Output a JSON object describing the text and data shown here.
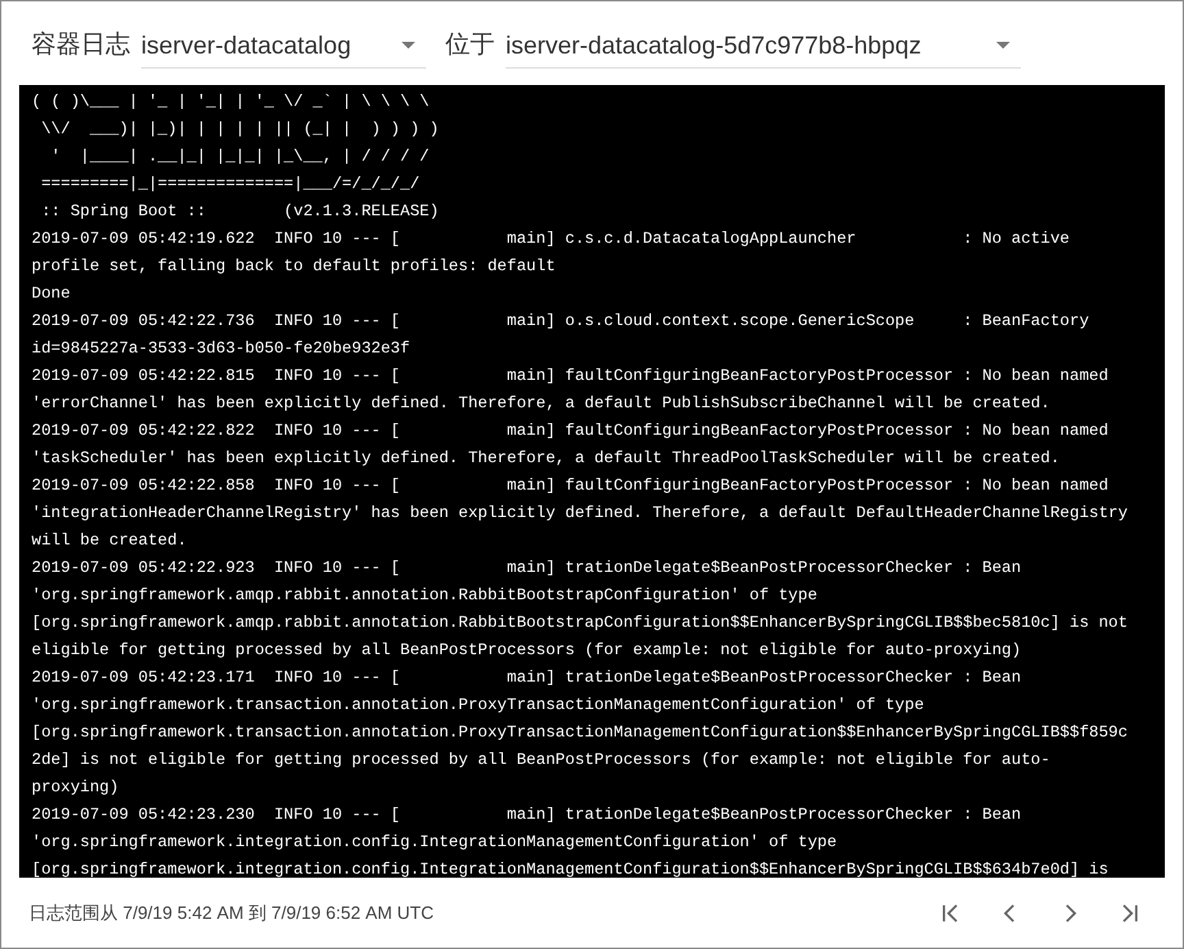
{
  "header": {
    "log_label": "容器日志",
    "container_select": {
      "value": "iserver-datacatalog"
    },
    "location_label": "位于",
    "pod_select": {
      "value": "iserver-datacatalog-5d7c977b8-hbpqz"
    }
  },
  "log_lines": [
    "( ( )\\___ | '_ | '_| | '_ \\/ _` | \\ \\ \\ \\",
    " \\\\/  ___)| |_)| | | | | || (_| |  ) ) ) )",
    "  '  |____| .__|_| |_|_| |_\\__, | / / / /",
    " =========|_|==============|___/=/_/_/_/",
    " :: Spring Boot ::        (v2.1.3.RELEASE)",
    "2019-07-09 05:42:19.622  INFO 10 --- [           main] c.s.c.d.DatacatalogAppLauncher           : No active",
    "profile set, falling back to default profiles: default",
    "Done",
    "2019-07-09 05:42:22.736  INFO 10 --- [           main] o.s.cloud.context.scope.GenericScope     : BeanFactory",
    "id=9845227a-3533-3d63-b050-fe20be932e3f",
    "2019-07-09 05:42:22.815  INFO 10 --- [           main] faultConfiguringBeanFactoryPostProcessor : No bean named",
    "'errorChannel' has been explicitly defined. Therefore, a default PublishSubscribeChannel will be created.",
    "2019-07-09 05:42:22.822  INFO 10 --- [           main] faultConfiguringBeanFactoryPostProcessor : No bean named",
    "'taskScheduler' has been explicitly defined. Therefore, a default ThreadPoolTaskScheduler will be created.",
    "2019-07-09 05:42:22.858  INFO 10 --- [           main] faultConfiguringBeanFactoryPostProcessor : No bean named",
    "'integrationHeaderChannelRegistry' has been explicitly defined. Therefore, a default DefaultHeaderChannelRegistry",
    "will be created.",
    "2019-07-09 05:42:22.923  INFO 10 --- [           main] trationDelegate$BeanPostProcessorChecker : Bean",
    "'org.springframework.amqp.rabbit.annotation.RabbitBootstrapConfiguration' of type",
    "[org.springframework.amqp.rabbit.annotation.RabbitBootstrapConfiguration$$EnhancerBySpringCGLIB$$bec5810c] is not",
    "eligible for getting processed by all BeanPostProcessors (for example: not eligible for auto-proxying)",
    "2019-07-09 05:42:23.171  INFO 10 --- [           main] trationDelegate$BeanPostProcessorChecker : Bean",
    "'org.springframework.transaction.annotation.ProxyTransactionManagementConfiguration' of type",
    "[org.springframework.transaction.annotation.ProxyTransactionManagementConfiguration$$EnhancerBySpringCGLIB$$f859c",
    "2de] is not eligible for getting processed by all BeanPostProcessors (for example: not eligible for auto-",
    "proxying)",
    "2019-07-09 05:42:23.230  INFO 10 --- [           main] trationDelegate$BeanPostProcessorChecker : Bean",
    "'org.springframework.integration.config.IntegrationManagementConfiguration' of type",
    "[org.springframework.integration.config.IntegrationManagementConfiguration$$EnhancerBySpringCGLIB$$634b7e0d] is"
  ],
  "footer": {
    "range_text": "日志范围从 7/9/19 5:42 AM 到 7/9/19 6:52 AM UTC",
    "pagination": [
      {
        "kind": "first"
      },
      {
        "kind": "previous"
      },
      {
        "kind": "next"
      },
      {
        "kind": "last"
      }
    ]
  }
}
